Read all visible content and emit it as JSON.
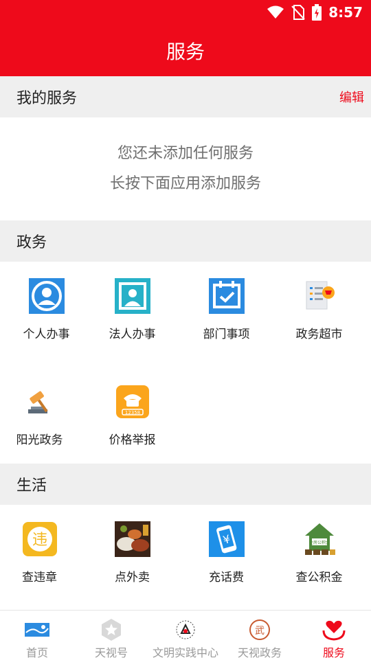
{
  "status": {
    "time": "8:57"
  },
  "header": {
    "title": "服务"
  },
  "my_services": {
    "title": "我的服务",
    "edit": "编辑",
    "empty_line1": "您还未添加任何服务",
    "empty_line2": "长按下面应用添加服务"
  },
  "gov": {
    "title": "政务",
    "items": [
      {
        "label": "个人办事",
        "icon": "person-icon"
      },
      {
        "label": "法人办事",
        "icon": "corporate-person-icon"
      },
      {
        "label": "部门事项",
        "icon": "calendar-check-icon"
      },
      {
        "label": "政务超市",
        "icon": "document-cart-icon"
      },
      {
        "label": "阳光政务",
        "icon": "gavel-icon"
      },
      {
        "label": "价格举报",
        "icon": "phone-12358-icon"
      }
    ]
  },
  "life": {
    "title": "生活",
    "items": [
      {
        "label": "查违章",
        "icon": "violation-icon",
        "icon_text": "违"
      },
      {
        "label": "点外卖",
        "icon": "food-icon"
      },
      {
        "label": "充话费",
        "icon": "phone-recharge-icon",
        "icon_text": "¥"
      },
      {
        "label": "查公积金",
        "icon": "housing-fund-icon",
        "icon_text": "住房公积金"
      }
    ]
  },
  "tabs": [
    {
      "label": "首页",
      "icon": "home-logo-icon"
    },
    {
      "label": "天视号",
      "icon": "star-badge-icon"
    },
    {
      "label": "文明实践中心",
      "icon": "civilization-logo-icon"
    },
    {
      "label": "天视政务",
      "icon": "gov-seal-icon",
      "icon_text": "武"
    },
    {
      "label": "服务",
      "icon": "heart-hand-icon"
    }
  ],
  "colors": {
    "accent": "#ee0a1b",
    "section_bg": "#efefef",
    "blue": "#2b8be0",
    "teal": "#27b1c8",
    "orange": "#fba51c"
  }
}
